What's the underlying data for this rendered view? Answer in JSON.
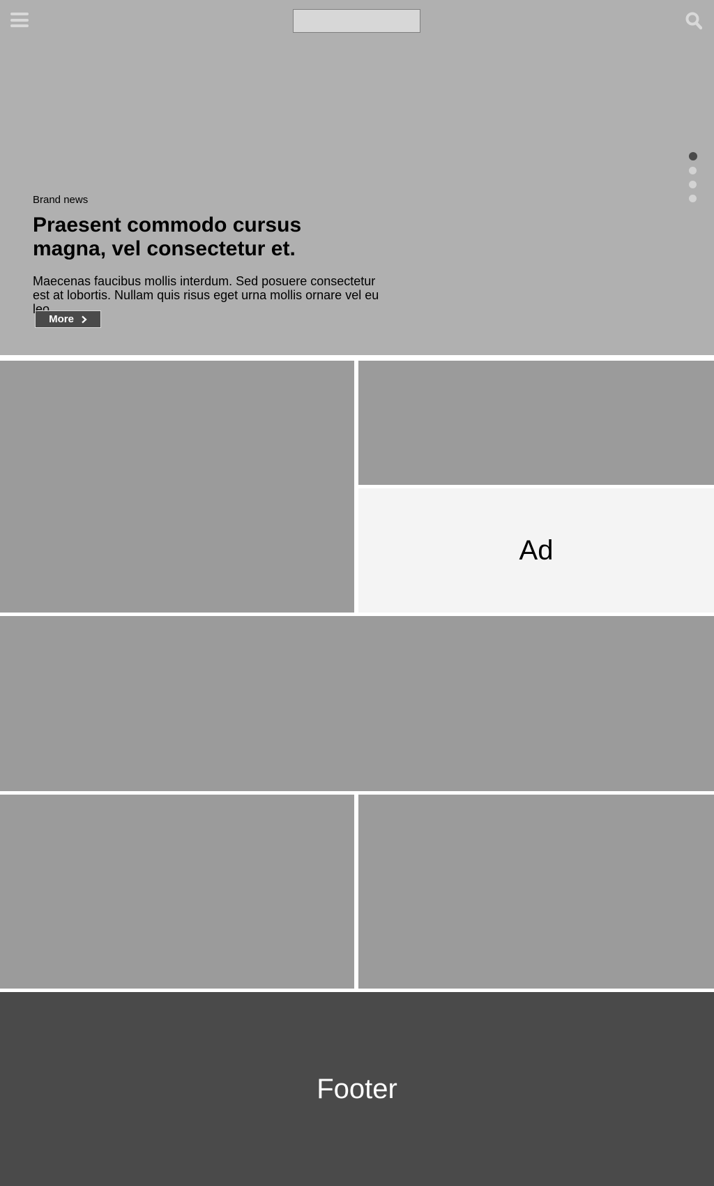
{
  "header": {
    "menu_icon": "hamburger-menu-icon",
    "search_icon": "search-icon"
  },
  "hero": {
    "kicker": "Brand news",
    "headline": "Praesent commodo cursus magna, vel consectetur et.",
    "summary": "Maecenas faucibus mollis interdum. Sed posuere consectetur est at lobortis. Nullam quis risus eget urna mollis ornare vel eu leo.",
    "cta_label": "More",
    "cta_icon": "chevron-right-icon",
    "slide_count": 4,
    "active_slide": 1
  },
  "ad": {
    "label": "Ad"
  },
  "footer": {
    "label": "Footer"
  },
  "colors": {
    "hero_bg": "#b0b0b0",
    "tile_bg": "#9b9b9b",
    "ad_bg": "#f4f4f4",
    "footer_bg": "#4a4a4a",
    "button_bg": "#4a4a4a",
    "dot_active": "#4a4a4a",
    "dot_inactive": "#d3d3d3"
  }
}
